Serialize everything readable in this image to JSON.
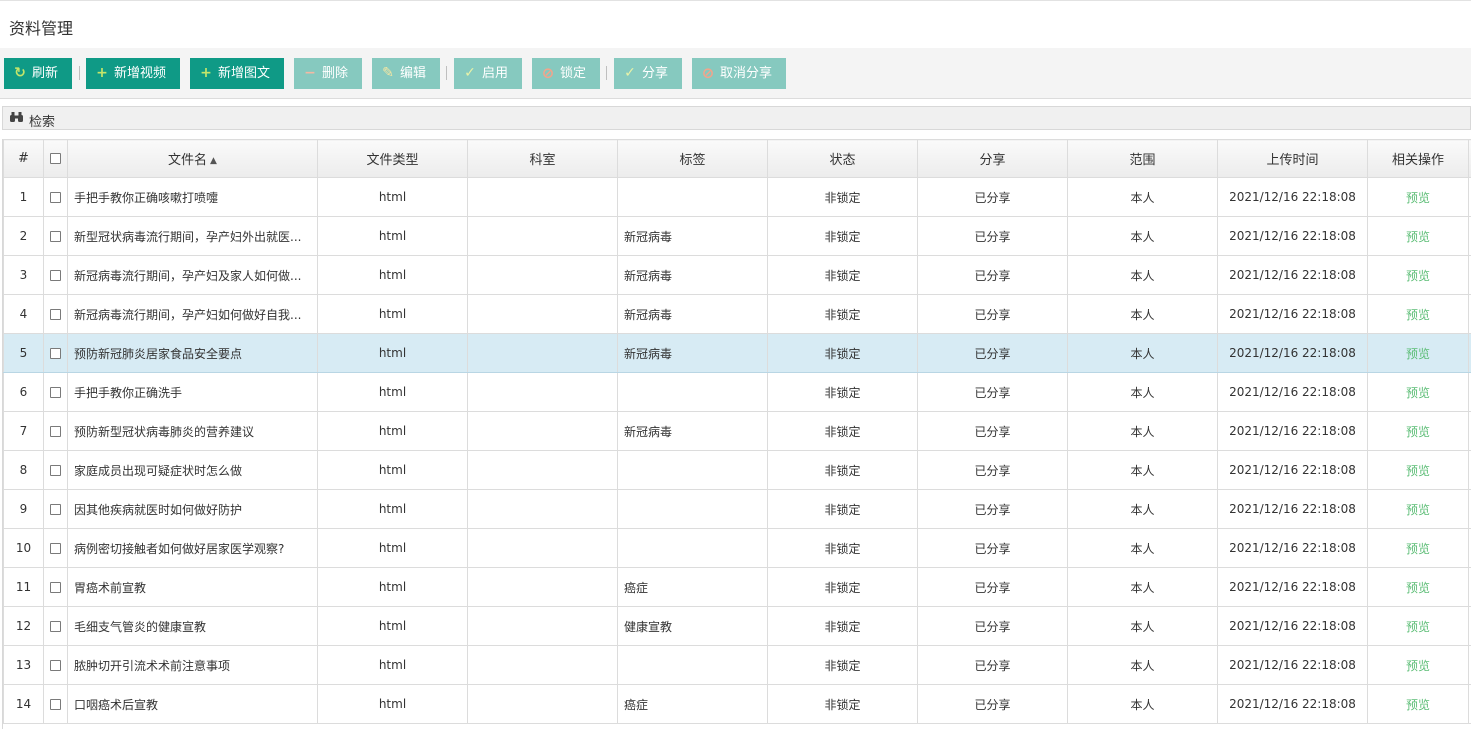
{
  "page": {
    "title": "资料管理"
  },
  "toolbar": {
    "refresh": "刷新",
    "add_video": "新增视频",
    "add_article": "新增图文",
    "delete": "删除",
    "edit": "编辑",
    "enable": "启用",
    "lock": "锁定",
    "share": "分享",
    "unshare": "取消分享"
  },
  "search": {
    "label": "检索"
  },
  "table": {
    "columns": {
      "index": "#",
      "filename": "文件名",
      "filetype": "文件类型",
      "department": "科室",
      "tag": "标签",
      "status": "状态",
      "share": "分享",
      "scope": "范围",
      "upload_time": "上传时间",
      "actions": "相关操作"
    },
    "sort": {
      "column": "文件名",
      "direction": "asc"
    },
    "rows": [
      {
        "index": "1",
        "name": "手把手教你正确咳嗽打喷嚏",
        "type": "html",
        "dept": "",
        "tag": "",
        "status": "非锁定",
        "share": "已分享",
        "scope": "本人",
        "time": "2021/12/16 22:18:08",
        "action": "预览"
      },
      {
        "index": "2",
        "name": "新型冠状病毒流行期间，孕产妇外出就医...",
        "type": "html",
        "dept": "",
        "tag": "新冠病毒",
        "status": "非锁定",
        "share": "已分享",
        "scope": "本人",
        "time": "2021/12/16 22:18:08",
        "action": "预览"
      },
      {
        "index": "3",
        "name": "新冠病毒流行期间，孕产妇及家人如何做...",
        "type": "html",
        "dept": "",
        "tag": "新冠病毒",
        "status": "非锁定",
        "share": "已分享",
        "scope": "本人",
        "time": "2021/12/16 22:18:08",
        "action": "预览"
      },
      {
        "index": "4",
        "name": "新冠病毒流行期间，孕产妇如何做好自我...",
        "type": "html",
        "dept": "",
        "tag": "新冠病毒",
        "status": "非锁定",
        "share": "已分享",
        "scope": "本人",
        "time": "2021/12/16 22:18:08",
        "action": "预览"
      },
      {
        "index": "5",
        "name": "预防新冠肺炎居家食品安全要点",
        "type": "html",
        "dept": "",
        "tag": "新冠病毒",
        "status": "非锁定",
        "share": "已分享",
        "scope": "本人",
        "time": "2021/12/16 22:18:08",
        "action": "预览",
        "selected": true
      },
      {
        "index": "6",
        "name": "手把手教你正确洗手",
        "type": "html",
        "dept": "",
        "tag": "",
        "status": "非锁定",
        "share": "已分享",
        "scope": "本人",
        "time": "2021/12/16 22:18:08",
        "action": "预览"
      },
      {
        "index": "7",
        "name": "预防新型冠状病毒肺炎的营养建议",
        "type": "html",
        "dept": "",
        "tag": "新冠病毒",
        "status": "非锁定",
        "share": "已分享",
        "scope": "本人",
        "time": "2021/12/16 22:18:08",
        "action": "预览"
      },
      {
        "index": "8",
        "name": "家庭成员出现可疑症状时怎么做",
        "type": "html",
        "dept": "",
        "tag": "",
        "status": "非锁定",
        "share": "已分享",
        "scope": "本人",
        "time": "2021/12/16 22:18:08",
        "action": "预览"
      },
      {
        "index": "9",
        "name": "因其他疾病就医时如何做好防护",
        "type": "html",
        "dept": "",
        "tag": "",
        "status": "非锁定",
        "share": "已分享",
        "scope": "本人",
        "time": "2021/12/16 22:18:08",
        "action": "预览"
      },
      {
        "index": "10",
        "name": "病例密切接触者如何做好居家医学观察?",
        "type": "html",
        "dept": "",
        "tag": "",
        "status": "非锁定",
        "share": "已分享",
        "scope": "本人",
        "time": "2021/12/16 22:18:08",
        "action": "预览"
      },
      {
        "index": "11",
        "name": "胃癌术前宣教",
        "type": "html",
        "dept": "",
        "tag": "癌症",
        "status": "非锁定",
        "share": "已分享",
        "scope": "本人",
        "time": "2021/12/16 22:18:08",
        "action": "预览"
      },
      {
        "index": "12",
        "name": "毛细支气管炎的健康宣教",
        "type": "html",
        "dept": "",
        "tag": "健康宣教",
        "status": "非锁定",
        "share": "已分享",
        "scope": "本人",
        "time": "2021/12/16 22:18:08",
        "action": "预览"
      },
      {
        "index": "13",
        "name": "脓肿切开引流术术前注意事项",
        "type": "html",
        "dept": "",
        "tag": "",
        "status": "非锁定",
        "share": "已分享",
        "scope": "本人",
        "time": "2021/12/16 22:18:08",
        "action": "预览"
      },
      {
        "index": "14",
        "name": "口咽癌术后宣教",
        "type": "html",
        "dept": "",
        "tag": "癌症",
        "status": "非锁定",
        "share": "已分享",
        "scope": "本人",
        "time": "2021/12/16 22:18:08",
        "action": "预览"
      }
    ]
  },
  "colors": {
    "button_active": "#0f9a86",
    "button_disabled": "#86c9bf",
    "selected_row": "#d7ebf4",
    "link": "#5bbd75"
  },
  "icons": {
    "refresh": "refresh-icon",
    "add": "plus-icon",
    "delete": "minus-icon",
    "edit": "pencil-icon",
    "enable": "check-icon",
    "lock": "ban-icon",
    "share": "check-icon",
    "unshare": "ban-icon",
    "search": "binoculars-icon"
  }
}
